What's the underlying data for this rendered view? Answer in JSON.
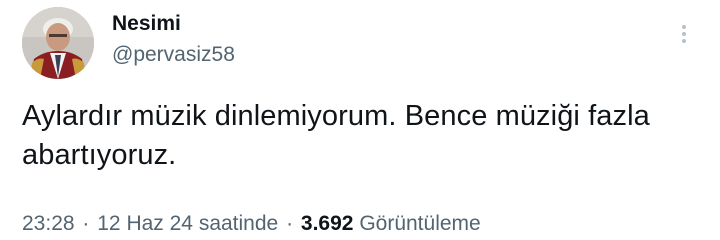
{
  "author": {
    "display_name": "Nesimi",
    "handle": "@pervasiz58"
  },
  "tweet": {
    "text": "Aylardır müzik dinlemiyorum. Bence müziği fazla abartıyoruz."
  },
  "meta": {
    "time": "23:28",
    "separator": "·",
    "date": "12 Haz 24 saatinde",
    "views_count": "3.692",
    "views_label": "Görüntüleme"
  },
  "icons": {
    "more": "more-vertical-icon",
    "avatar": "profile-photo"
  },
  "colors": {
    "text_primary": "#0f1419",
    "text_secondary": "#536471",
    "background": "#ffffff"
  }
}
